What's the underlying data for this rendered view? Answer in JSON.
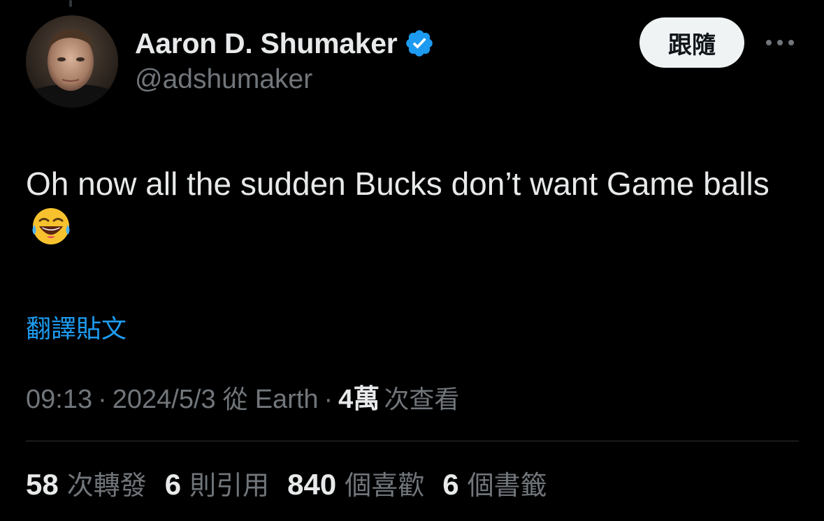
{
  "author": {
    "display_name": "Aaron D. Shumaker",
    "handle": "@adshumaker",
    "verified": true,
    "verified_icon": "verified-badge-icon",
    "avatar_icon": "avatar"
  },
  "actions": {
    "follow_label": "跟隨",
    "more_icon": "more-options-icon"
  },
  "tweet": {
    "text": "Oh now all the sudden Bucks don’t want Game balls",
    "emoji": "face-with-tears-of-joy-icon",
    "translate_label": "翻譯貼文"
  },
  "meta": {
    "time": "09:13",
    "separator": "·",
    "date": "2024/5/3",
    "source_prefix": "從",
    "source": "Earth",
    "views_count": "4萬",
    "views_label": "次查看"
  },
  "stats": [
    {
      "count": "58",
      "label": "次轉發"
    },
    {
      "count": "6",
      "label": "則引用"
    },
    {
      "count": "840",
      "label": "個喜歡"
    },
    {
      "count": "6",
      "label": "個書籤"
    }
  ],
  "colors": {
    "background": "#000000",
    "primary_text": "#e7e9ea",
    "secondary_text": "#71767b",
    "link_blue": "#1d9bf0",
    "follow_button_bg": "#eff3f4",
    "divider": "#2f3336"
  }
}
